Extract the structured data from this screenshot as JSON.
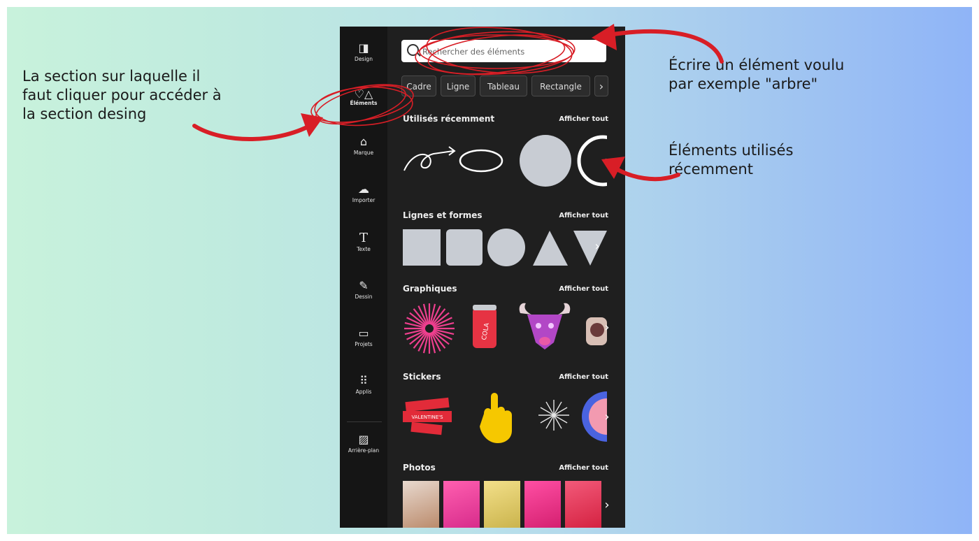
{
  "annotations": {
    "left": "La section sur laquelle il\nfaut cliquer pour accéder à\nla section desing",
    "right_top": "Écrire un élément voulu\npar exemple \"arbre\"",
    "right_mid": "Éléments utilisés\nrécemment"
  },
  "sidebar": {
    "items": [
      {
        "label": "Design",
        "icon": "design-icon"
      },
      {
        "label": "Éléments",
        "icon": "elements-icon",
        "active": true
      },
      {
        "label": "Marque",
        "icon": "brand-icon"
      },
      {
        "label": "Importer",
        "icon": "upload-icon"
      },
      {
        "label": "Texte",
        "icon": "text-icon"
      },
      {
        "label": "Dessin",
        "icon": "draw-icon"
      },
      {
        "label": "Projets",
        "icon": "folder-icon"
      },
      {
        "label": "Applis",
        "icon": "apps-icon"
      },
      {
        "label": "Arrière-plan",
        "icon": "background-icon"
      }
    ]
  },
  "search": {
    "placeholder": "Rechercher des éléments"
  },
  "chips": [
    "Cadre",
    "Ligne",
    "Tableau",
    "Rectangle"
  ],
  "sections": [
    {
      "title": "Utilisés récemment",
      "more": "Afficher tout"
    },
    {
      "title": "Lignes et formes",
      "more": "Afficher tout"
    },
    {
      "title": "Graphiques",
      "more": "Afficher tout"
    },
    {
      "title": "Stickers",
      "more": "Afficher tout"
    },
    {
      "title": "Photos",
      "more": "Afficher tout"
    }
  ],
  "colors": {
    "accent_red": "#d81e26",
    "panel_bg": "#1f1f1f",
    "shape_fill": "#c8ccd3"
  }
}
